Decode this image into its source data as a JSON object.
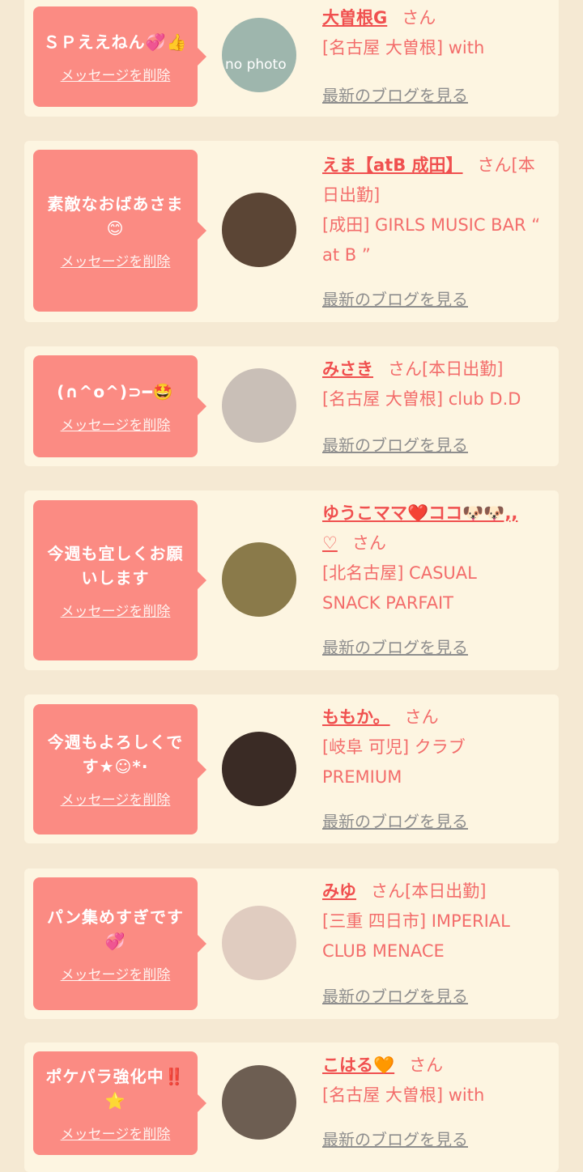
{
  "common": {
    "delete_label": "メッセージを削除",
    "blog_label": "最新のブログを見る",
    "san": "さん"
  },
  "cards": [
    {
      "message": "ＳＰええねん💞👍",
      "name": "大曽根G",
      "suffix": "",
      "shop_lines": [
        "[名古屋 大曽根] with"
      ],
      "avatar_text": "no photo",
      "avatar_color": "#9eb6ad"
    },
    {
      "message": "素敵なおばあさま😊",
      "name": "えま【atB 成田】",
      "suffix": "[本日出勤]",
      "shop_lines": [
        "[成田] GIRLS MUSIC BAR “",
        "at B ”"
      ],
      "avatar_color": "#5b4535"
    },
    {
      "message": "(∩^o^)⊃━🤩",
      "name": "みさき",
      "suffix": "[本日出勤]",
      "shop_lines": [
        "[名古屋 大曽根] club D.D"
      ],
      "avatar_color": "#c9bfb7"
    },
    {
      "message": "今週も宜しくお願いします",
      "name": "ゆうこママ❤️ココ🐶🐶,,",
      "name_line2": "♡",
      "suffix": "",
      "shop_lines": [
        "[北名古屋] CASUAL",
        "SNACK PARFAIT"
      ],
      "avatar_color": "#8a7a4a"
    },
    {
      "message": "今週もよろしくです★☺*·",
      "name": "ももか。",
      "suffix": "",
      "shop_lines": [
        "[岐阜 可児] クラブ",
        "PREMIUM"
      ],
      "avatar_color": "#3a2b25"
    },
    {
      "message": "パン集めすぎです💞",
      "name": "みゆ",
      "suffix": "[本日出勤]",
      "shop_lines": [
        "[三重 四日市] IMPERIAL",
        "CLUB MENACE"
      ],
      "avatar_color": "#e0ccc0"
    },
    {
      "message": "ポケパラ強化中‼️⭐",
      "name": "こはる🧡",
      "suffix": "",
      "shop_lines": [
        "[名古屋 大曽根] with"
      ],
      "avatar_color": "#6d5e52"
    }
  ]
}
